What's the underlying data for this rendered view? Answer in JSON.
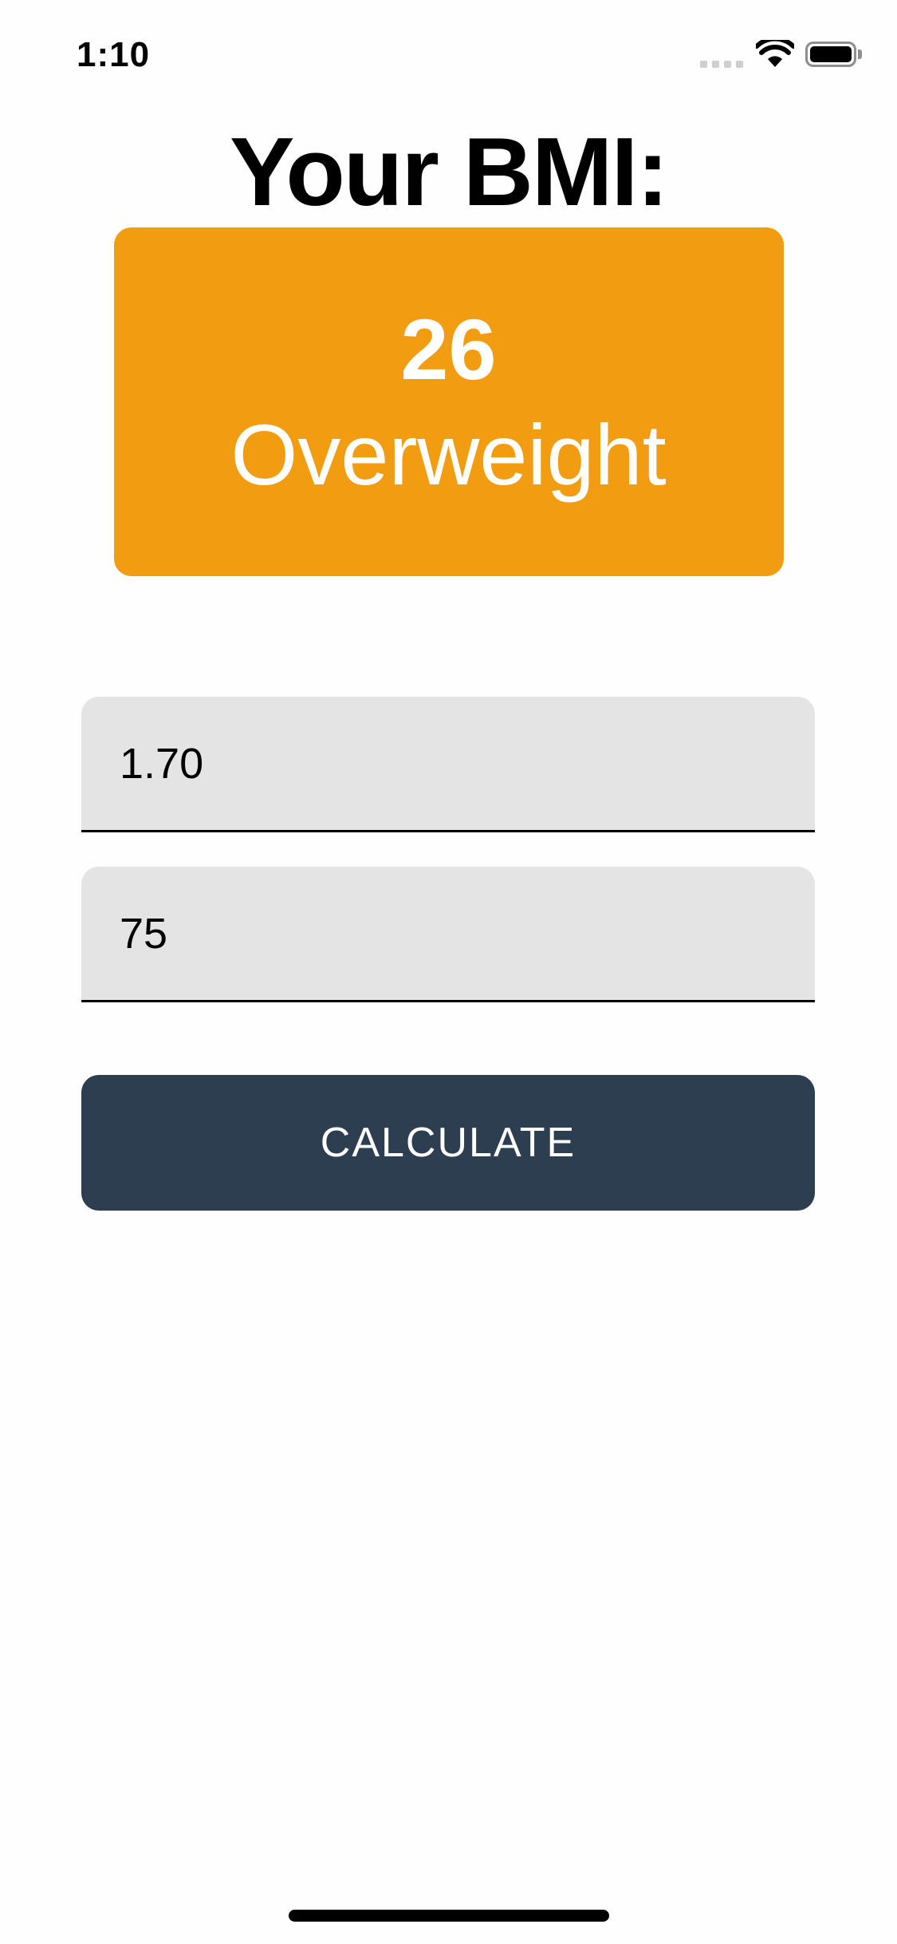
{
  "status_bar": {
    "time": "1:10",
    "signal_icon": "cellular-signal-icon",
    "wifi_icon": "wifi-icon",
    "battery_icon": "battery-icon"
  },
  "header": {
    "title": "Your BMI:"
  },
  "result": {
    "value": "26",
    "category": "Overweight",
    "background_color": "#f29c12"
  },
  "form": {
    "height_value": "1.70",
    "weight_value": "75",
    "calculate_label": "CALCULATE",
    "button_color": "#2e3e51"
  }
}
